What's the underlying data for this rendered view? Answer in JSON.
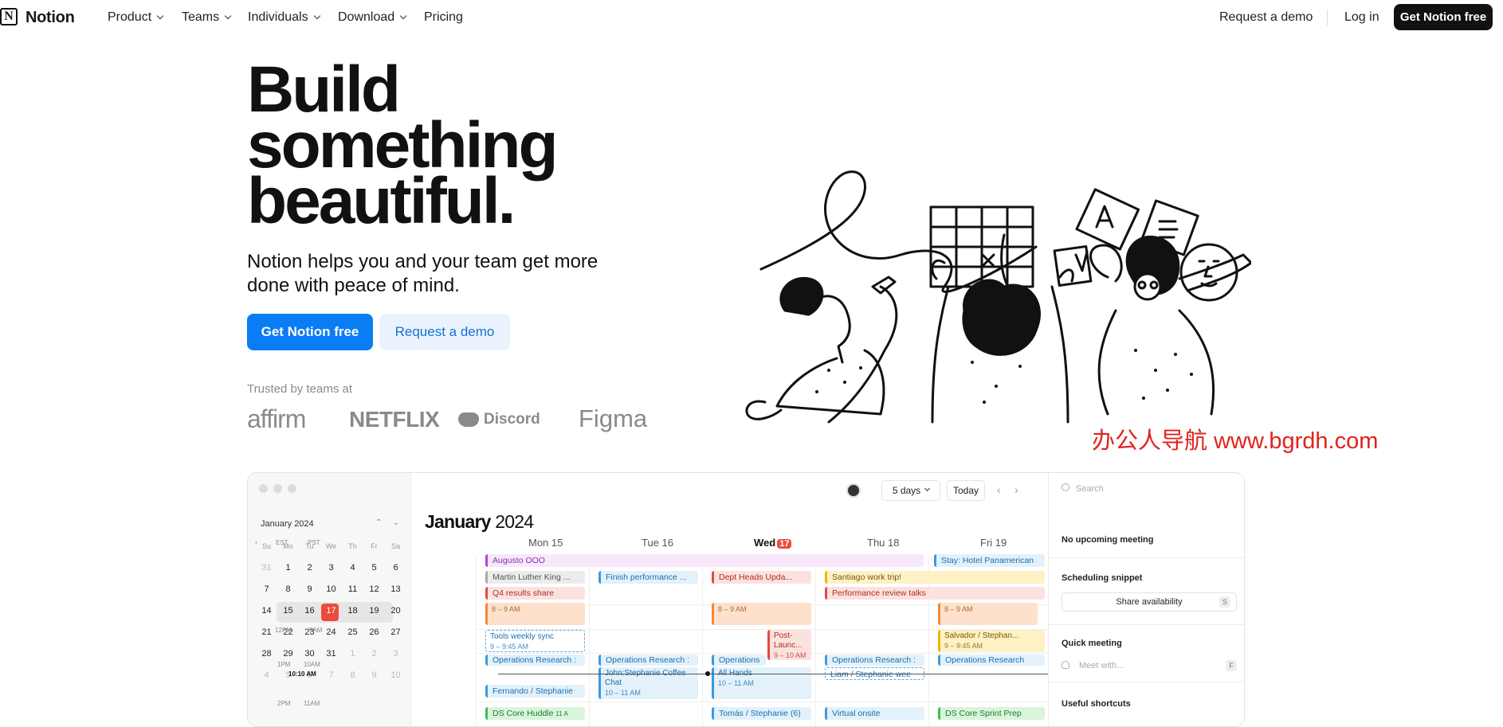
{
  "nav": {
    "logo_letter": "N",
    "logo_text": "Notion",
    "items": [
      {
        "label": "Product",
        "dropdown": true
      },
      {
        "label": "Teams",
        "dropdown": true
      },
      {
        "label": "Individuals",
        "dropdown": true
      },
      {
        "label": "Download",
        "dropdown": true
      },
      {
        "label": "Pricing",
        "dropdown": false
      }
    ],
    "request_demo": "Request a demo",
    "login": "Log in",
    "cta": "Get Notion free"
  },
  "hero": {
    "title_lines": [
      "Build",
      "something",
      "beautiful."
    ],
    "subtitle": "Notion helps you and your team get more done with peace of mind.",
    "primary_cta": "Get Notion free",
    "secondary_cta": "Request a demo",
    "trusted_label": "Trusted by teams at",
    "brands": [
      "affirm",
      "NETFLIX",
      "Discord",
      "Figma"
    ],
    "watermark": "办公人导航 www.bgrdh.com"
  },
  "app": {
    "mini_calendar": {
      "title": "January 2024",
      "weekdays": [
        "Su",
        "Mo",
        "Tu",
        "We",
        "Th",
        "Fr",
        "Sa"
      ],
      "weeks": [
        [
          "31",
          "1",
          "2",
          "3",
          "4",
          "5",
          "6"
        ],
        [
          "7",
          "8",
          "9",
          "10",
          "11",
          "12",
          "13"
        ],
        [
          "14",
          "15",
          "16",
          "17",
          "18",
          "19",
          "20"
        ],
        [
          "21",
          "22",
          "23",
          "24",
          "25",
          "26",
          "27"
        ],
        [
          "28",
          "29",
          "30",
          "31",
          "1",
          "2",
          "3"
        ],
        [
          "4",
          "5",
          "6",
          "7",
          "8",
          "9",
          "10"
        ]
      ],
      "today": "17"
    },
    "calendar": {
      "title_month": "January",
      "title_year": "2024",
      "view": "5 days",
      "today_btn": "Today",
      "timezones": [
        "EST",
        "PST"
      ],
      "days": [
        {
          "label": "Mon 15"
        },
        {
          "label": "Tue 16"
        },
        {
          "label": "Wed",
          "badge": "17"
        },
        {
          "label": "Thu 18"
        },
        {
          "label": "Fri 19"
        }
      ],
      "time_labels": {
        "est_12pm": "12PM",
        "pst_9am": "9AM",
        "est_1pm": "1PM",
        "pst_10am": "10AM",
        "now": "10:10 AM",
        "est_2pm": "2PM",
        "pst_11am": "11AM"
      },
      "events": {
        "augusto": "Augusto OOO",
        "stay": "Stay: Hotel Panamerican",
        "mlk": "Martin Luther King ...",
        "finish_perf": "Finish performance ...",
        "dept_heads": "Dept Heads Upda...",
        "santiago": "Santiago work trip!",
        "q4": "Q4 results share",
        "perf_review": "Performance review talks",
        "mon_block_time": "8 – 9 AM",
        "wed_block_time": "8 – 9 AM",
        "fri_block_time": "8 – 9 AM",
        "tools_sync": "Tools weekly sync",
        "tools_sync_time": "9 – 9:45 AM",
        "post_launch": "Post-Launc...",
        "post_launch_time": "9 – 10 AM",
        "salvador": "Salvador / Stephan...",
        "salvador_time": "9 – 9:45 AM",
        "ops_mon": "Operations Research :",
        "ops_tue": "Operations Research :",
        "ops_wed": "Operations",
        "ops_thu": "Operations Research :",
        "ops_fri": "Operations Research",
        "john": "John:Stephanie Coffee Chat",
        "john_time": "10 – 11 AM",
        "all_hands": "All Hands",
        "all_hands_time": "10 – 11 AM",
        "liam": "Liam / Stephanie wee",
        "fernando": "Fernando / Stephanie",
        "ds_huddle": "DS Core Huddle",
        "ds_huddle_time": "11 A",
        "tomas": "Tomás / Stephanie (6)",
        "virtual": "Virtual onsite",
        "ds_sprint": "DS Core Sprint Prep"
      }
    },
    "right_panel": {
      "search_placeholder": "Search",
      "no_meeting": "No upcoming meeting",
      "snippet_title": "Scheduling snippet",
      "share_btn": "Share availability",
      "share_key": "S",
      "quick_title": "Quick meeting",
      "meet_placeholder": "Meet with...",
      "meet_key": "F",
      "shortcuts_title": "Useful shortcuts"
    }
  }
}
